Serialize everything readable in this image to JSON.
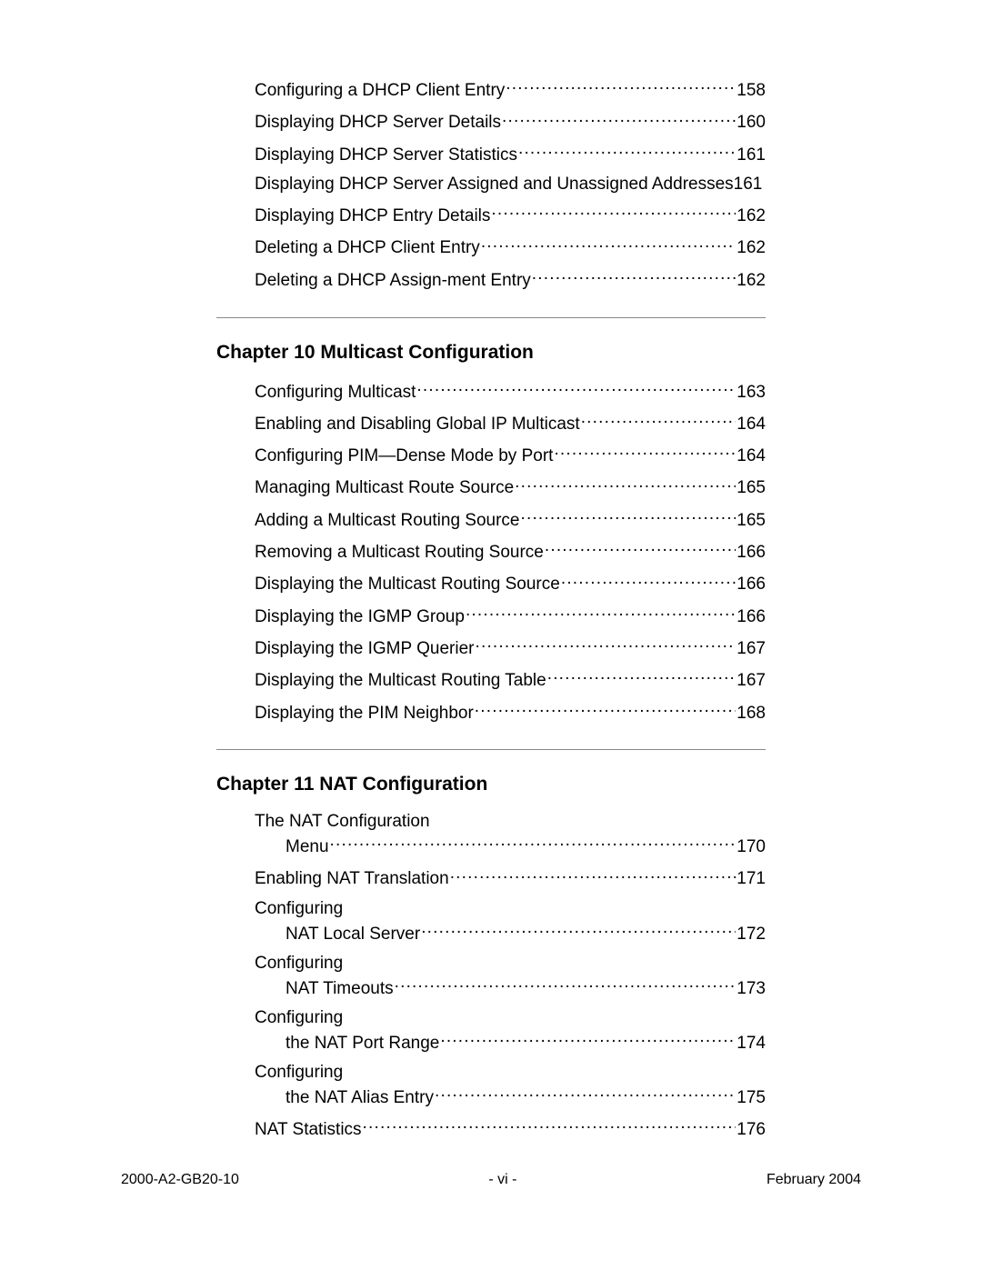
{
  "footer": {
    "doc_id": "2000-A2-GB20-10",
    "page_roman": "- vi -",
    "date": "February 2004"
  },
  "block_pre": {
    "entries": [
      {
        "label": "Configuring a DHCP Client Entry ",
        "page": "158"
      },
      {
        "label": "Displaying DHCP Server Details ",
        "page": "160"
      },
      {
        "label": "Displaying DHCP Server Statistics",
        "page": "161"
      },
      {
        "label": "Displaying DHCP Server Assigned and Unassigned Addresses",
        "page": "161"
      },
      {
        "label": "Displaying DHCP Entry Details ",
        "page": "162"
      },
      {
        "label": "Deleting a DHCP Client Entry",
        "page": "162"
      },
      {
        "label": "Deleting a DHCP Assign-ment Entry",
        "page": "162"
      }
    ]
  },
  "chapter10": {
    "title": "Chapter 10  Multicast Configuration",
    "entries": [
      {
        "label": "Configuring Multicast",
        "page": "163"
      },
      {
        "label": "Enabling and Disabling Global IP Multicast",
        "page": "164"
      },
      {
        "label": "Configuring PIM—Dense Mode by Port ",
        "page": "164"
      },
      {
        "label": "Managing Multicast Route Source",
        "page": "165"
      },
      {
        "label": "Adding a Multicast Routing Source ",
        "page": "165"
      },
      {
        "label": "Removing a Multicast Routing Source ",
        "page": "166"
      },
      {
        "label": "Displaying the Multicast Routing Source",
        "page": "166"
      },
      {
        "label": "Displaying the IGMP Group",
        "page": "166"
      },
      {
        "label": "Displaying the IGMP Querier",
        "page": "167"
      },
      {
        "label": "Displaying the Multicast Routing Table",
        "page": "167"
      },
      {
        "label": "Displaying the PIM Neighbor",
        "page": "168"
      }
    ]
  },
  "chapter11": {
    "title": "Chapter 11  NAT Configuration",
    "entries": [
      {
        "wrap": true,
        "line1": "The NAT Configuration",
        "line2": "Menu ",
        "page": "170"
      },
      {
        "label": "Enabling NAT Translation",
        "page": "171"
      },
      {
        "wrap": true,
        "line1": "Configuring",
        "line2": "NAT Local Server",
        "page": "172"
      },
      {
        "wrap": true,
        "line1": "Configuring",
        "line2": "NAT Timeouts",
        "page": "173"
      },
      {
        "wrap": true,
        "line1": "Configuring",
        "line2": "the NAT Port Range",
        "page": "174"
      },
      {
        "wrap": true,
        "line1": "Configuring",
        "line2": "the NAT Alias Entry",
        "page": "175"
      },
      {
        "label": "NAT Statistics ",
        "page": "176"
      }
    ]
  }
}
